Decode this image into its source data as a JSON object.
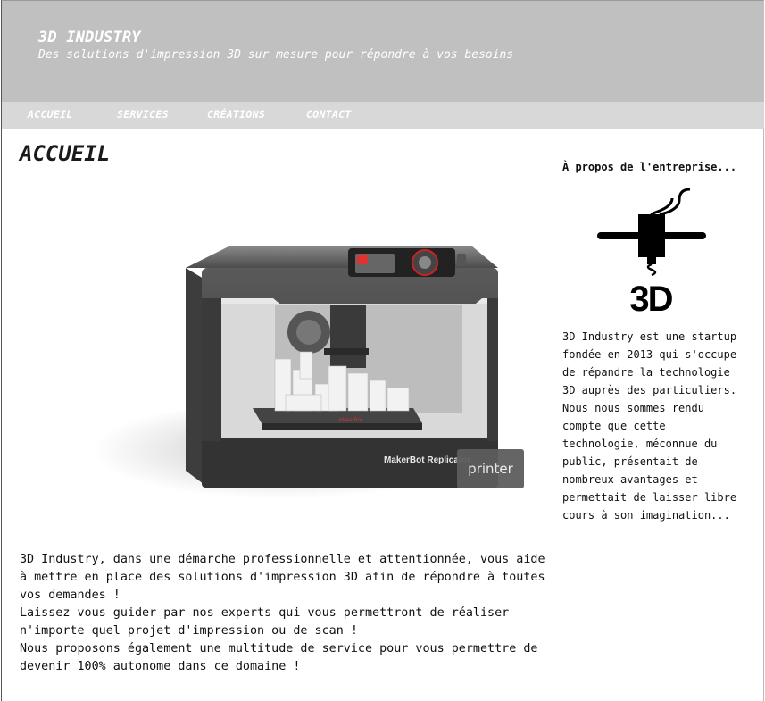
{
  "header": {
    "title": "3D INDUSTRY",
    "tagline": "Des solutions d'impression 3D sur mesure pour répondre à vos besoins"
  },
  "nav": {
    "items": [
      {
        "label": "ACCUEIL"
      },
      {
        "label": "SERVICES"
      },
      {
        "label": "CRÉATIONS"
      },
      {
        "label": "CONTACT"
      }
    ]
  },
  "main": {
    "heading": "ACCUEIL",
    "hero": {
      "printer_brand": "MakerBot Replicator",
      "plate_brand": "MakerBot",
      "caption": "printer"
    },
    "paragraphs": [
      "3D Industry, dans une démarche professionnelle et attentionnée, vous aide à mettre en place des solutions d'impression 3D afin de répondre à toutes vos demandes !",
      "Laissez vous guider par nos experts qui vous permettront de réaliser n'importe quel projet d'impression ou de scan !",
      "Nous proposons également une multitude de service pour vous permettre de devenir 100% autonome dans ce domaine !"
    ]
  },
  "aside": {
    "title": "À propos de l'entreprise...",
    "logo_text": "3D",
    "text": "3D Industry est une startup fondée en 2013 qui s'occupe de répandre la technologie 3D auprès des particuliers. Nous nous sommes rendu compte que cette technologie, méconnue du public, présentait de nombreux avantages et permettait de laisser libre cours à son imagination..."
  },
  "colors": {
    "header_bg": "#c0c0c0",
    "nav_bg": "#d8d8d8",
    "header_text": "#ffffff"
  }
}
